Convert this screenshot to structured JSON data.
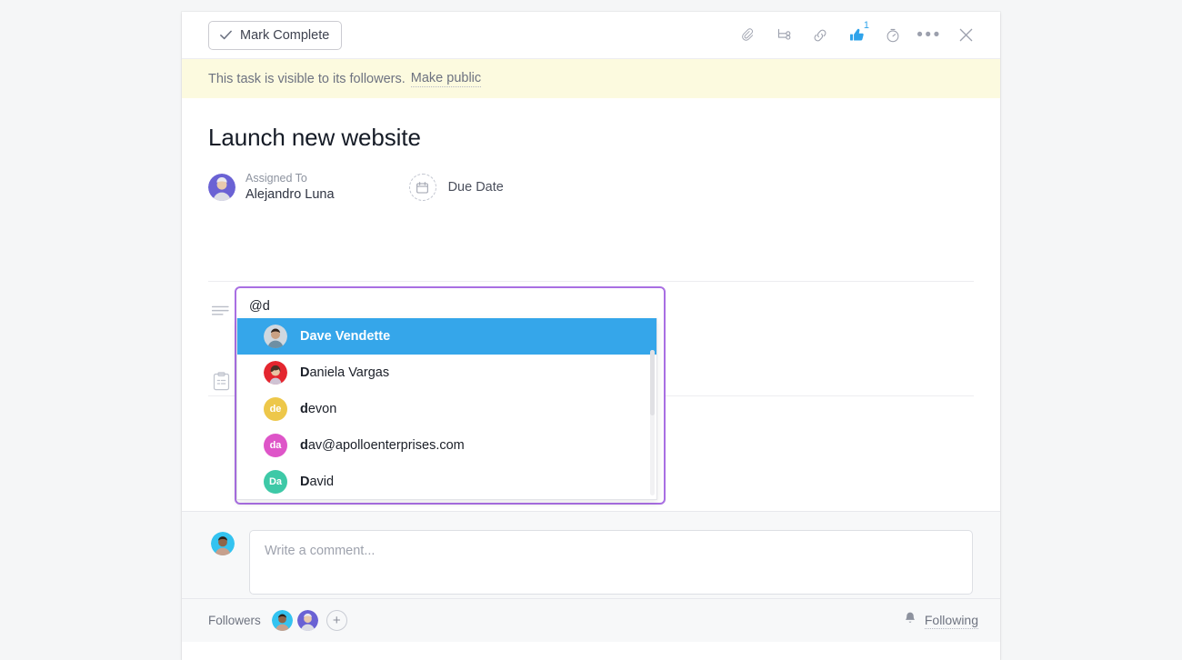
{
  "toolbar": {
    "mark_complete_label": "Mark Complete",
    "icons": [
      {
        "name": "attachment-icon",
        "title": "Attach file"
      },
      {
        "name": "subtask-icon",
        "title": "Add subtask"
      },
      {
        "name": "link-icon",
        "title": "Copy task link"
      },
      {
        "name": "thumbs-up-icon",
        "title": "Like",
        "count": "1",
        "active_color": "#2fa3ea"
      },
      {
        "name": "timer-icon",
        "title": "Track time"
      },
      {
        "name": "more-options-icon",
        "title": "More"
      },
      {
        "name": "close-icon",
        "title": "Close"
      }
    ],
    "like_count": "1"
  },
  "notice": {
    "text": "This task is visible to its followers.",
    "link_label": "Make public",
    "background": "#fcfadf"
  },
  "task": {
    "title": "Launch new website",
    "assignee": {
      "label": "Assigned To",
      "name": "Alejandro Luna",
      "avatar_color": "#6a62d4"
    },
    "due_date": {
      "label": "Due Date",
      "value": ""
    }
  },
  "mention_editor": {
    "input_value": "@d",
    "focus_border_color": "#a96fe3",
    "selected_index": 0,
    "suggestions": [
      {
        "bold": "D",
        "rest": "ave Vendette",
        "full": "Dave Vendette",
        "avatar_type": "photo",
        "avatar_color": "#cfd8e0",
        "selected": true
      },
      {
        "bold": "D",
        "rest": "aniela Vargas",
        "full": "Daniela Vargas",
        "avatar_type": "photo",
        "avatar_color": "#e4262f",
        "selected": false
      },
      {
        "bold": "d",
        "rest": "evon",
        "full": "devon",
        "avatar_type": "initials",
        "initials": "de",
        "avatar_color": "#edc74a",
        "selected": false
      },
      {
        "bold": "d",
        "rest": "av@apolloenterprises.com",
        "full": "dav@apolloenterprises.com",
        "avatar_type": "initials",
        "initials": "da",
        "avatar_color": "#de55c8",
        "selected": false
      },
      {
        "bold": "D",
        "rest": "avid",
        "full": "David",
        "avatar_type": "initials",
        "initials": "Da",
        "avatar_color": "#3ec9a7",
        "selected": false
      }
    ],
    "highlight_color": "#35a6ea"
  },
  "comment": {
    "placeholder": "Write a comment...",
    "avatar_color": "#34c3f0"
  },
  "followers": {
    "label": "Followers",
    "avatars": [
      {
        "name": "follower-avatar-1",
        "color": "#34c3f0"
      },
      {
        "name": "follower-avatar-2",
        "color": "#6a62d4"
      }
    ],
    "add_label": "+",
    "following_label": "Following",
    "bell_icon": "bell-icon"
  }
}
